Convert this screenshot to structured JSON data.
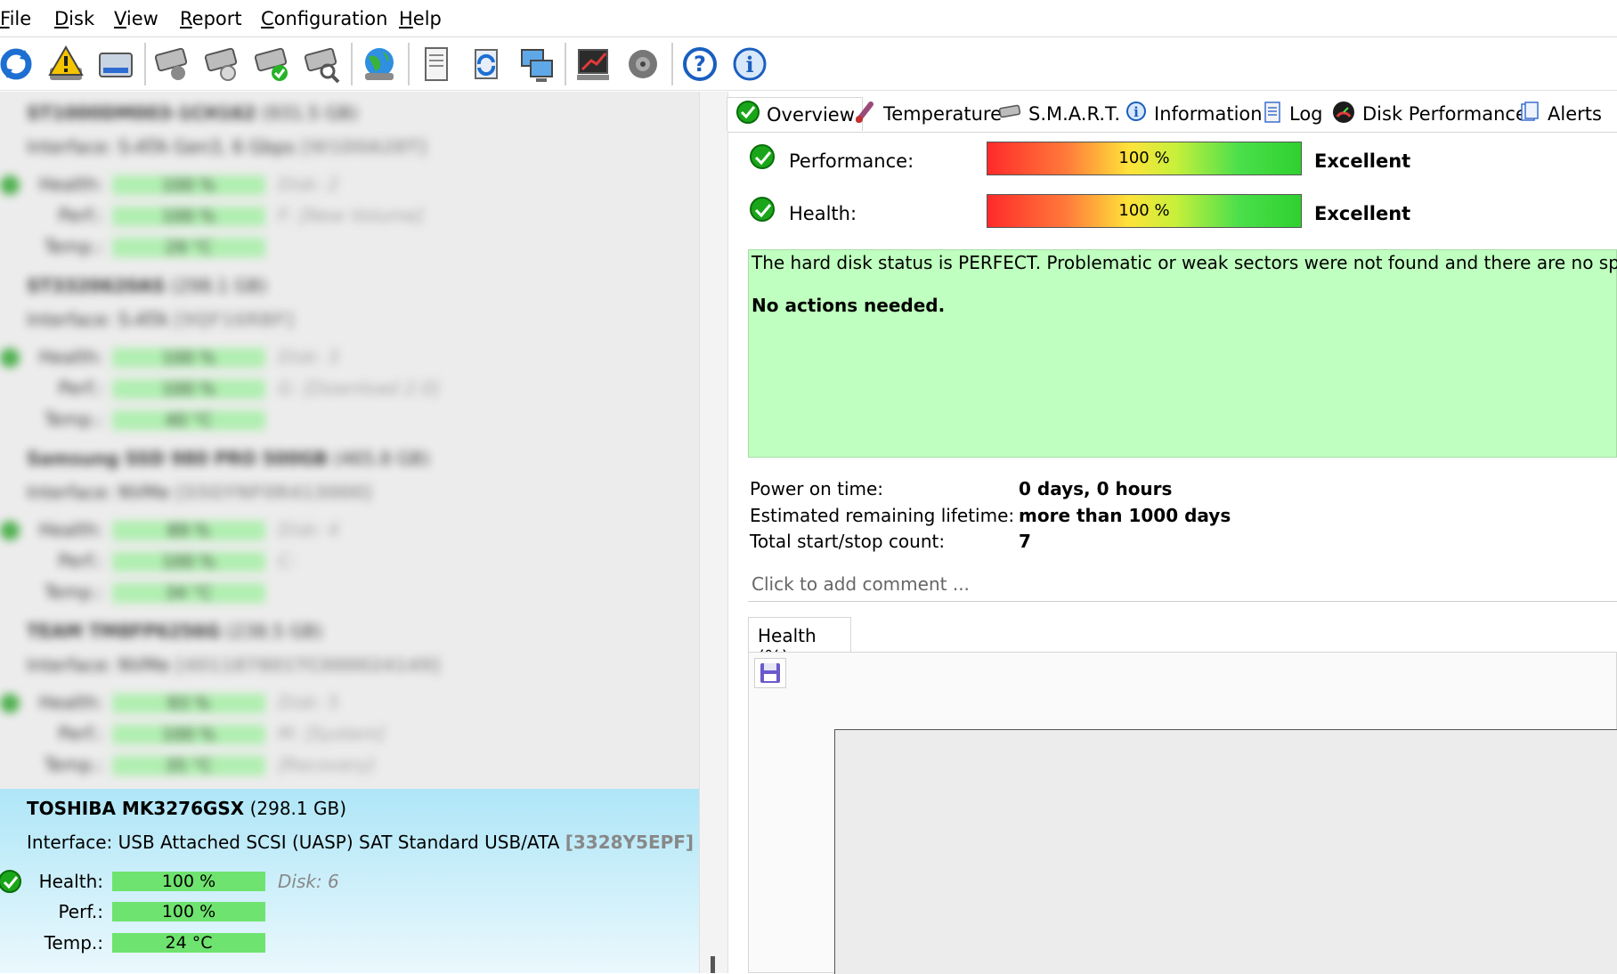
{
  "menu": [
    "File",
    "Disk",
    "View",
    "Report",
    "Configuration",
    "Help"
  ],
  "toolbar": {
    "icons": [
      "refresh-icon",
      "alert-icon",
      "disk-icon",
      "disk-tools-icon-1",
      "disk-tools-icon-2",
      "disk-ok-icon",
      "disk-search-icon",
      "globe-icon",
      "report-icon",
      "sync-icon",
      "network-icon",
      "benchmark-icon",
      "sound-icon",
      "help-icon",
      "info-icon"
    ]
  },
  "disks": [
    {
      "name": "ST1000DM003-1CH162",
      "size": "(931.5 GB)",
      "interface_label": "Interface:",
      "interface": "S-ATA Gen3, 6 Gbps",
      "serial": "[W1D0A28T]",
      "health": "100 %",
      "perf": "100 %",
      "temp": "29 °C",
      "disk_note": "Disk: 2",
      "perf_note": "F: [New Volume]",
      "temp_note": ""
    },
    {
      "name": "ST3320620AS",
      "size": "(298.1 GB)",
      "interface_label": "Interface:",
      "interface": "S-ATA",
      "serial": "[9QF16RBF]",
      "health": "100 %",
      "perf": "100 %",
      "temp": "40 °C",
      "disk_note": "Disk: 3",
      "perf_note": "G: [Download 2.0]",
      "temp_note": ""
    },
    {
      "name": "Samsung SSD 980 PRO 500GB",
      "size": "(465.8 GB)",
      "interface_label": "Interface:",
      "interface": "NVMe",
      "serial": "[S5GYNF0R413000]",
      "health": "89 %",
      "perf": "100 %",
      "temp": "34 °C",
      "disk_note": "Disk: 4",
      "perf_note": "C:",
      "temp_note": ""
    },
    {
      "name": "TEAM TM8FP6256G",
      "size": "(238.5 GB)",
      "interface_label": "Interface:",
      "interface": "NVMe",
      "serial": "[401187801TC000024149]",
      "health": "93 %",
      "perf": "100 %",
      "temp": "35 °C",
      "disk_note": "Disk: 5",
      "perf_note": "M: [System]",
      "temp_note": "[Recovery]"
    }
  ],
  "selected_disk": {
    "name": "TOSHIBA MK3276GSX",
    "size": "(298.1 GB)",
    "interface_label": "Interface:",
    "interface": "USB Attached SCSI (UASP) SAT Standard USB/ATA",
    "serial": "[3328Y5EPF]",
    "health_label": "Health:",
    "perf_label": "Perf.:",
    "temp_label": "Temp.:",
    "health": "100 %",
    "perf": "100 %",
    "temp": "24 °C",
    "disk_note": "Disk: 6"
  },
  "labels": {
    "health": "Health:",
    "perf": "Perf.:",
    "temp": "Temp.:"
  },
  "tabs": [
    {
      "label": "Overview",
      "icon": "check-icon"
    },
    {
      "label": "Temperature",
      "icon": "thermometer-icon"
    },
    {
      "label": "S.M.A.R.T.",
      "icon": "disk-icon"
    },
    {
      "label": "Information",
      "icon": "info-icon"
    },
    {
      "label": "Log",
      "icon": "log-icon"
    },
    {
      "label": "Disk Performance",
      "icon": "gauge-icon"
    },
    {
      "label": "Alerts",
      "icon": "alerts-icon"
    }
  ],
  "overview": {
    "performance_label": "Performance:",
    "performance_value": "100 %",
    "performance_rating": "Excellent",
    "health_label": "Health:",
    "health_value": "100 %",
    "health_rating": "Excellent",
    "status_message": "The hard disk status is PERFECT. Problematic or weak sectors were not found and there are no spin up",
    "action_message": "No actions needed.",
    "power_on_label": "Power on time:",
    "power_on_value": "0 days, 0 hours",
    "lifetime_label": "Estimated remaining lifetime:",
    "lifetime_value": "more than 1000 days",
    "startstop_label": "Total start/stop count:",
    "startstop_value": "7",
    "comment_placeholder": "Click to add comment ...",
    "graph_tab": "Health (%)"
  },
  "colors": {
    "selected_bg": "#aee6f7",
    "status_bg": "#bfffbf",
    "bar_green": "#6fe36f",
    "ok_green": "#1aa61a"
  }
}
